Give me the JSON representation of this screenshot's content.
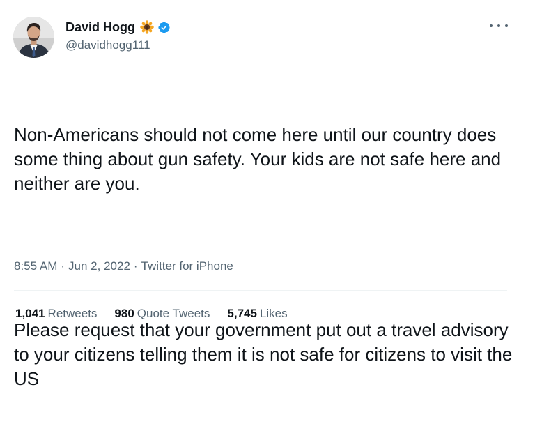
{
  "author": {
    "display_name": "David Hogg",
    "emoji_icon": "sunflower-icon",
    "verified_icon": "verified-badge-icon",
    "handle": "@davidhogg111"
  },
  "tweet": {
    "paragraph_1": "Non-Americans should not come here until our country does some thing about gun safety. Your kids are not safe here and neither are you.",
    "paragraph_2": "Please request that your government put out a travel advisory to your citizens telling them it is not safe for citizens to visit the US"
  },
  "meta": {
    "time": "8:55 AM",
    "date": "Jun 2, 2022",
    "source": "Twitter for iPhone",
    "separator": "·"
  },
  "stats": {
    "retweets_count": "1,041",
    "retweets_label": "Retweets",
    "quotes_count": "980",
    "quotes_label": "Quote Tweets",
    "likes_count": "5,745",
    "likes_label": "Likes"
  },
  "colors": {
    "text": "#0f1419",
    "secondary": "#536471",
    "verified": "#1d9bf0",
    "divider": "#eff3f4"
  }
}
